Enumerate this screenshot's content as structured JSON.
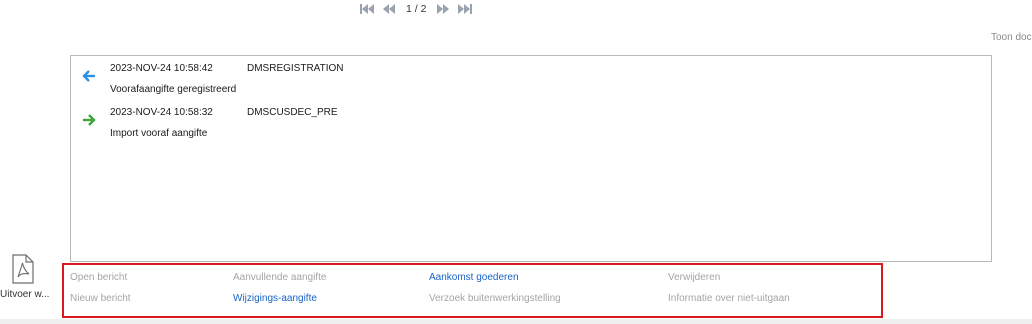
{
  "pager": {
    "page_info": "1 / 2",
    "icons": [
      "first-page-icon",
      "previous-page-icon",
      "next-page-icon",
      "last-page-icon"
    ],
    "icon_color": "#9aa3ad"
  },
  "top_link": "Toon doc",
  "messages": [
    {
      "direction": "incoming",
      "icon": "arrow-left-icon",
      "arrow_color": "#2d8fe0",
      "timestamp": "2023-NOV-24 10:58:42",
      "source": "DMSREGISTRATION",
      "description": "Voorafaangifte geregistreerd"
    },
    {
      "direction": "outgoing",
      "icon": "arrow-right-icon",
      "arrow_color": "#3fa535",
      "timestamp": "2023-NOV-24 10:58:32",
      "source": "DMSCUSDEC_PRE",
      "description": "Import vooraf aangifte"
    }
  ],
  "side_button": {
    "icon": "pdf-icon",
    "label": "Uitvoer w..."
  },
  "actions": {
    "open_bericht": "Open bericht",
    "nieuw_bericht": "Nieuw bericht",
    "aanvullende_aangifte": "Aanvullende aangifte",
    "wijzigings_aangifte": "Wijzigings-aangifte",
    "aankomst_goederen": "Aankomst goederen",
    "verzoek_buitenwerkingstelling": "Verzoek buitenwerkingstelling",
    "verwijderen": "Verwijderen",
    "informatie_niet_uitgaan": "Informatie over niet-uitgaan"
  },
  "colors": {
    "link_enabled": "#1864c9",
    "link_disabled": "#a5a5a5",
    "highlight_border": "#d9191e"
  }
}
